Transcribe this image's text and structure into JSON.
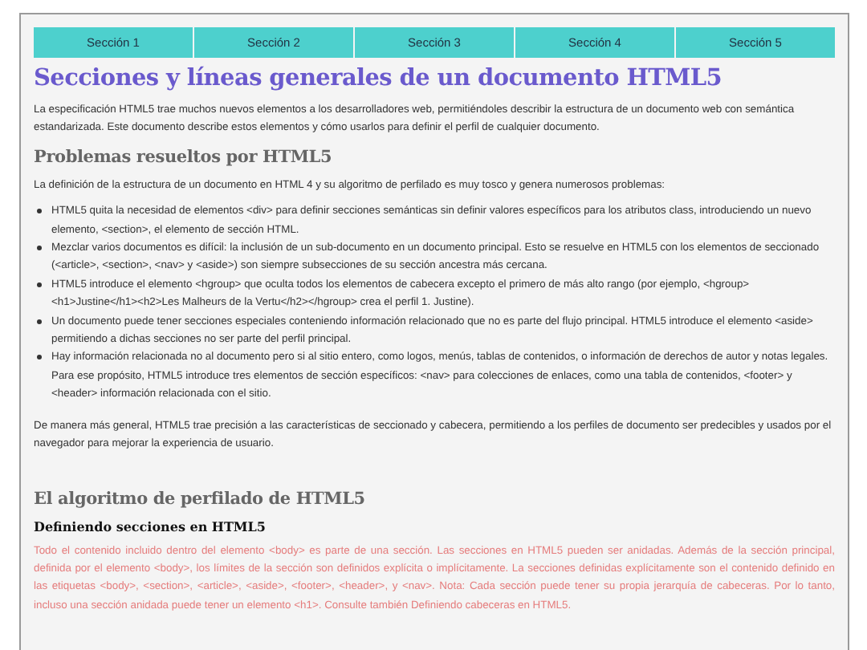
{
  "nav": [
    "Sección 1",
    "Sección 2",
    "Sección 3",
    "Sección 4",
    "Sección 5"
  ],
  "content": [
    {
      "kind": "h1",
      "text": "Secciones y líneas generales de un documento HTML5"
    },
    {
      "kind": "p",
      "text": "La especificación HTML5 trae muchos nuevos elementos a los desarrolladores web, permitiéndoles describir la estructura de un documento web con semántica estandarizada. Este documento describe estos elementos y cómo usarlos para definir el perfil de cualquier documento."
    },
    {
      "kind": "h2",
      "text": "Problemas resueltos por HTML5"
    },
    {
      "kind": "p",
      "text": "La definición de la estructura de un documento en HTML 4 y su algoritmo de perfilado es muy tosco y genera numerosos problemas:"
    },
    {
      "kind": "list",
      "items": [
        "HTML5 quita la necesidad de elementos <div> para definir secciones semánticas sin definir valores específicos para los atributos class, introduciendo un nuevo elemento, <section>, el elemento de sección HTML.",
        "Mezclar varios documentos es difícil: la inclusión de un sub-documento en un documento principal. Esto se resuelve en HTML5 con los elementos de seccionado (<article>, <section>, <nav> y <aside>) son siempre subsecciones de su sección ancestra más cercana.",
        "HTML5 introduce el elemento <hgroup> que oculta todos los elementos de cabecera excepto el primero de más alto rango (por ejemplo, <hgroup><h1>Justine</h1><h2>Les Malheurs de la Vertu</h2></hgroup> crea el perfil 1. Justine).",
        "Un documento puede tener secciones especiales conteniendo información relacionado que no es parte del flujo principal. HTML5 introduce el elemento <aside> permitiendo a dichas secciones no ser parte del perfil principal.",
        "Hay información relacionada no al documento pero si al sitio entero, como logos, menús, tablas de contenidos, o información de derechos de autor y notas legales. Para ese propósito, HTML5 introduce tres elementos de sección específicos: <nav> para colecciones de enlaces, como una tabla de contenidos, <footer> y <header> información relacionada con el sitio."
      ]
    },
    {
      "kind": "p",
      "text": "De manera más general, HTML5 trae precisión a las características de seccionado y cabecera, permitiendo a los perfiles de documento ser predecibles y usados por el navegador para mejorar la experiencia de usuario."
    },
    {
      "kind": "h2",
      "text": "El algoritmo de perfilado de HTML5"
    },
    {
      "kind": "h3",
      "text": "Definiendo secciones en HTML5"
    },
    {
      "kind": "note",
      "text": "Todo el contenido incluido dentro del elemento <body> es parte de una sección. Las secciones en HTML5 pueden ser anidadas. Además de la sección principal, definida por el elemento <body>, los límites de la sección son definidos explícita o implícitamente. La secciones definidas explícitamente son el contenido definido en las etiquetas <body>, <section>, <article>, <aside>, <footer>, <header>, y <nav>. Nota: Cada sección puede tener su propia jerarquía de cabeceras. Por lo tanto, incluso una sección anidada puede tener un elemento <h1>. Consulte también Definiendo cabeceras en HTML5."
    }
  ]
}
